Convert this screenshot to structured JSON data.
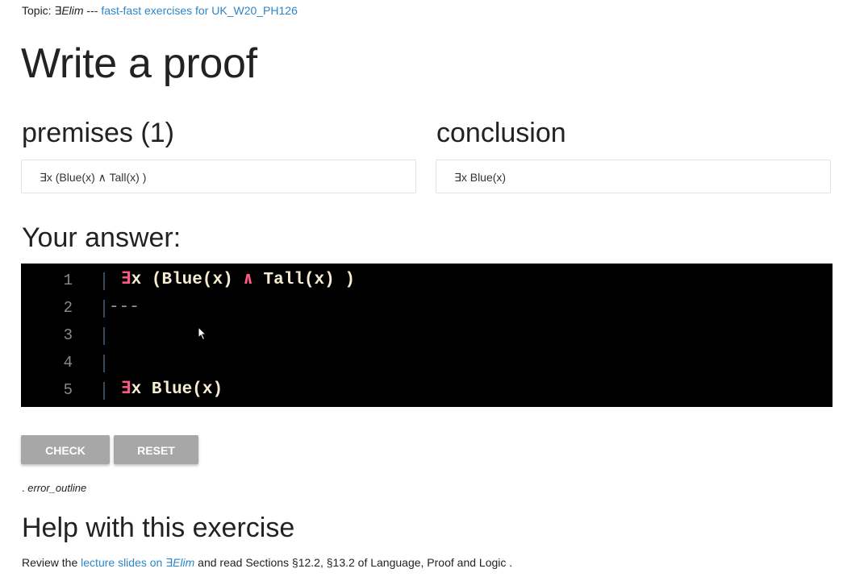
{
  "topic": {
    "prefix": "Topic: ",
    "rule": "∃Elim",
    "separator": " --- ",
    "link": "fast-fast exercises for UK_W20_PH126"
  },
  "page_title": "Write a proof",
  "premises": {
    "heading": "premises (1)",
    "items": [
      "∃x (Blue(x) ∧ Tall(x) )"
    ]
  },
  "conclusion": {
    "heading": "conclusion",
    "value": "∃x Blue(x)"
  },
  "answer": {
    "heading": "Your answer:",
    "lines": [
      {
        "num": "1",
        "kw": "∃",
        "rest": "x (Blue(x) ",
        "kw2": "∧",
        "rest2": " Tall(x) )"
      },
      {
        "num": "2",
        "dashes": "---"
      },
      {
        "num": "3"
      },
      {
        "num": "4"
      },
      {
        "num": "5",
        "kw": "∃",
        "rest": "x Blue(x)"
      }
    ]
  },
  "buttons": {
    "check": "CHECK",
    "reset": "RESET"
  },
  "status": {
    "dot": ". ",
    "icon_text": "error_outline"
  },
  "help": {
    "heading": "Help with this exercise",
    "text_before": "Review the ",
    "link_text": "lecture slides on ",
    "link_rule": "∃Elim",
    "text_after": " and read Sections §12.2, §13.2 of Language, Proof and Logic ."
  },
  "colors": {
    "link": "#2b86c9",
    "editor_bg": "#000000",
    "keyword": "#ff5a86",
    "button_bg": "#a7a7a7"
  }
}
